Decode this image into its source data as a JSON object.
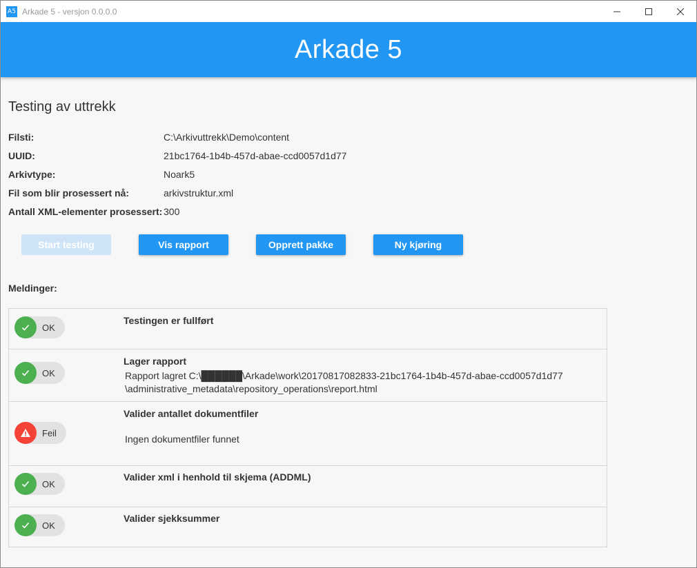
{
  "window": {
    "icon_text": "A5",
    "title": "Arkade 5 - versjon 0.0.0.0"
  },
  "header": {
    "title": "Arkade 5"
  },
  "page": {
    "title": "Testing av uttrekk",
    "info": [
      {
        "label": "Filsti:",
        "value": "C:\\Arkivuttrekk\\Demo\\content"
      },
      {
        "label": "UUID:",
        "value": "21bc1764-1b4b-457d-abae-ccd0057d1d77"
      },
      {
        "label": "Arkivtype:",
        "value": "Noark5"
      },
      {
        "label": "Fil som blir prosessert nå:",
        "value": "arkivstruktur.xml"
      },
      {
        "label": "Antall XML-elementer prosessert:",
        "value": "300"
      }
    ]
  },
  "buttons": {
    "start": "Start testing",
    "report": "Vis rapport",
    "package": "Opprett pakke",
    "new_run": "Ny kjøring"
  },
  "messages": {
    "label": "Meldinger:",
    "items": [
      {
        "status": "OK",
        "title": "Testingen er fullført",
        "body_lines": []
      },
      {
        "status": "OK",
        "title": "Lager rapport",
        "body_lines": [
          "Rapport lagret C:\\██████\\Arkade\\work\\20170817082833-21bc1764-1b4b-457d-abae-ccd0057d1d77",
          "\\administrative_metadata\\repository_operations\\report.html"
        ]
      },
      {
        "status": "Feil",
        "title": "Valider antallet dokumentfiler",
        "body_lines": [
          "Ingen dokumentfiler funnet"
        ]
      },
      {
        "status": "OK",
        "title": "Valider xml i henhold til skjema (ADDML)",
        "body_lines": []
      },
      {
        "status": "OK",
        "title": "Valider sjekksummer",
        "body_lines": []
      }
    ]
  },
  "colors": {
    "accent": "#2196f3",
    "ok": "#4caf50",
    "fail": "#f44336"
  }
}
